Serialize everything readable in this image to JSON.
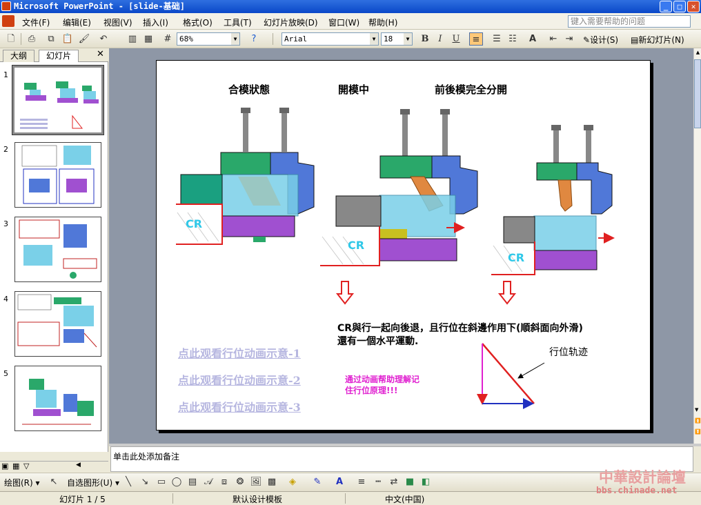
{
  "app_title": "Microsoft PowerPoint - [slide-基础]",
  "menu": [
    "文件(F)",
    "编辑(E)",
    "视图(V)",
    "插入(I)",
    "格式(O)",
    "工具(T)",
    "幻灯片放映(D)",
    "窗口(W)",
    "帮助(H)"
  ],
  "help_placeholder": "键入需要帮助的问题",
  "zoom": "68%",
  "font_name": "Arial",
  "font_size": "18",
  "toolbar_design": "设计(S)",
  "toolbar_new_slide": "新幻灯片(N)",
  "pane_tabs": [
    "大纲",
    "幻灯片"
  ],
  "slide_numbers": [
    "1",
    "2",
    "3",
    "4",
    "5"
  ],
  "slide": {
    "heading1": "合模狀態",
    "heading2": "開模中",
    "heading3": "前後模完全分開",
    "cr_labels": [
      "CR",
      "CR",
      "CR"
    ],
    "main_text_line1": "CR與行一起向後退，且行位在斜邊作用下(順斜面向外滑)",
    "main_text_line2": "還有一個水平運動.",
    "links": [
      "点此观看行位动画示意-1",
      "点此观看行位动画示意-2",
      "点此观看行位动画示意-3"
    ],
    "magenta_line1": "通过动画帮助理解记",
    "magenta_line2": "住行位原理!!!",
    "track_label": "行位轨迹"
  },
  "notes_placeholder": "单击此处添加备注",
  "drawbar": {
    "draw": "绘图(R)",
    "autoshapes": "自选图形(U)"
  },
  "status": {
    "slide": "幻灯片 1 / 5",
    "template": "默认设计模板",
    "language": "中文(中国)"
  },
  "watermark": {
    "line1": "中華設計論壇",
    "line2": "bbs.chinade.net"
  },
  "colors": {
    "title_bar": "#0a48c8",
    "green_block": "#2aa86a",
    "blue_block": "#5078d8",
    "purple_block": "#a050d0",
    "cyan_body": "#7ad0e8",
    "red_arrow": "#e02020",
    "magenta_text": "#e020d0"
  }
}
